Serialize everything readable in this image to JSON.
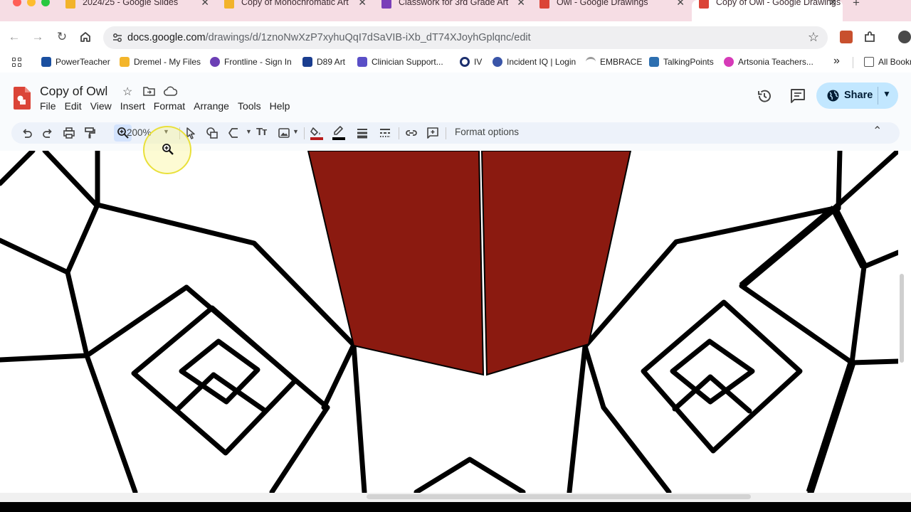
{
  "browser": {
    "tabs": [
      {
        "label": "2024/25 - Google Slides",
        "favicon_color": "#f2b32b"
      },
      {
        "label": "Copy of Monochromatic Art",
        "favicon_color": "#f2b32b"
      },
      {
        "label": "Classwork for 3rd Grade Art",
        "favicon_color": "#7a3fb8"
      },
      {
        "label": "Owl - Google Drawings",
        "favicon_color": "#db4437"
      },
      {
        "label": "Copy of Owl - Google Drawings",
        "favicon_color": "#db4437",
        "active": true
      }
    ],
    "address": {
      "domain": "docs.google.com",
      "path": "/drawings/d/1znoNwXzP7xyhuQqI7dSaVIB-iXb_dT74XJoyhGplqnc/edit"
    },
    "bookmarks": [
      {
        "label": "PowerTeacher",
        "icon_color": "#1a4fa0"
      },
      {
        "label": "Dremel - My Files",
        "icon_color": "#f3b52b"
      },
      {
        "label": "Frontline - Sign In",
        "icon_color": "#6c3fb5"
      },
      {
        "label": "D89 Art",
        "icon_color": "#1a3d8f"
      },
      {
        "label": "Clinician Support...",
        "icon_color": "#5a4fc7"
      },
      {
        "label": "IV",
        "icon_color": "#1c2f6e"
      },
      {
        "label": "Incident IQ | Login",
        "icon_color": "#3a55a8"
      },
      {
        "label": "EMBRACE",
        "icon_color": "#9a9a9a"
      },
      {
        "label": "TalkingPoints",
        "icon_color": "#2d6fb0"
      },
      {
        "label": "Artsonia Teachers...",
        "icon_color": "#d63ab8"
      }
    ],
    "bookmarks_overflow": "»",
    "all_bookmarks": "All Bookmarks"
  },
  "docs": {
    "title": "Copy of Owl",
    "menu": [
      "File",
      "Edit",
      "View",
      "Insert",
      "Format",
      "Arrange",
      "Tools",
      "Help"
    ],
    "share_label": "Share"
  },
  "toolbar": {
    "zoom": "200%",
    "format_options": "Format options",
    "fill_color": "#b71c1c",
    "border_color": "#000000"
  },
  "canvas": {
    "shape_fill": "#8b1a10",
    "stroke": "#000000"
  }
}
